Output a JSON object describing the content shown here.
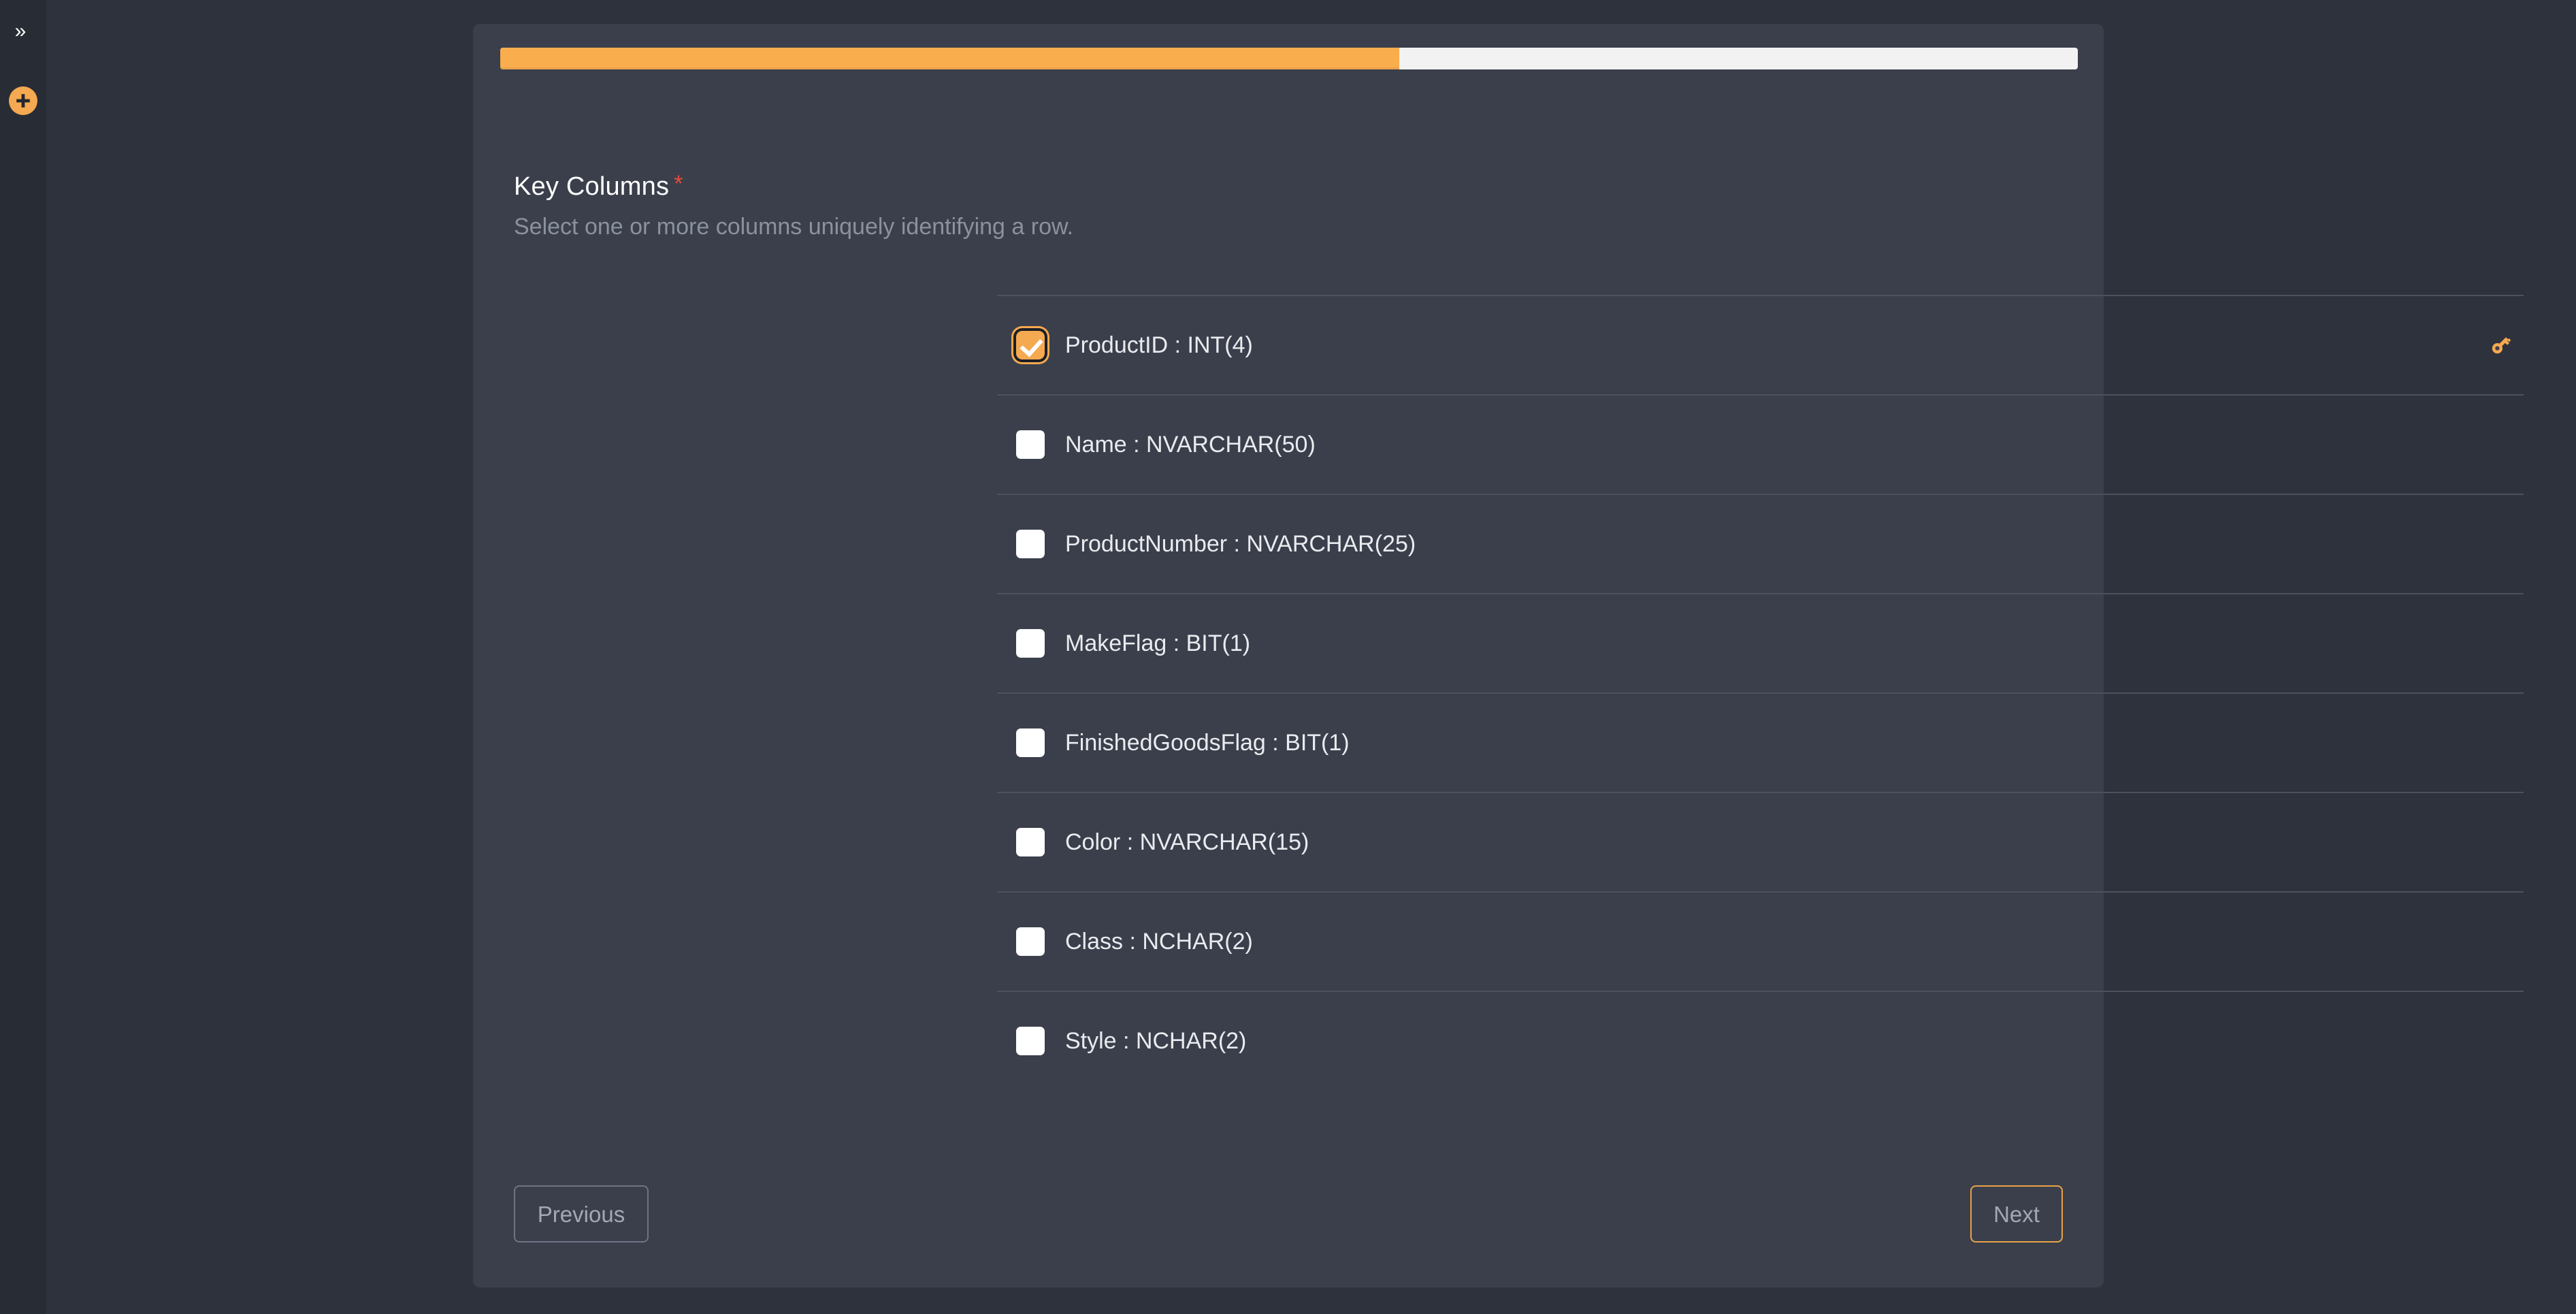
{
  "rail": {
    "expand_icon": "chevron-double-right-icon",
    "expand_label": "»",
    "add_icon": "plus-circle-icon",
    "accent_color": "#f5a950"
  },
  "wizard": {
    "progress": {
      "percent": 57,
      "fill_color": "#f9ad4d",
      "track_color": "#f2f2f2"
    },
    "section": {
      "title": "Key Columns",
      "required_marker": "*",
      "required_color": "#e74c3c",
      "subtitle": "Select one or more columns uniquely identifying a row."
    },
    "columns": [
      {
        "label": "ProductID : INT(4)",
        "name": "ProductID",
        "type": "INT",
        "length": "4",
        "checked": true,
        "key_icon": true
      },
      {
        "label": "Name : NVARCHAR(50)",
        "name": "Name",
        "type": "NVARCHAR",
        "length": "50",
        "checked": false,
        "key_icon": false
      },
      {
        "label": "ProductNumber : NVARCHAR(25)",
        "name": "ProductNumber",
        "type": "NVARCHAR",
        "length": "25",
        "checked": false,
        "key_icon": false
      },
      {
        "label": "MakeFlag : BIT(1)",
        "name": "MakeFlag",
        "type": "BIT",
        "length": "1",
        "checked": false,
        "key_icon": false
      },
      {
        "label": "FinishedGoodsFlag : BIT(1)",
        "name": "FinishedGoodsFlag",
        "type": "BIT",
        "length": "1",
        "checked": false,
        "key_icon": false
      },
      {
        "label": "Color : NVARCHAR(15)",
        "name": "Color",
        "type": "NVARCHAR",
        "length": "15",
        "checked": false,
        "key_icon": false
      },
      {
        "label": "Class : NCHAR(2)",
        "name": "Class",
        "type": "NCHAR",
        "length": "2",
        "checked": false,
        "key_icon": false
      },
      {
        "label": "Style : NCHAR(2)",
        "name": "Style",
        "type": "NCHAR",
        "length": "2",
        "checked": false,
        "key_icon": false
      }
    ],
    "footer": {
      "previous_label": "Previous",
      "next_label": "Next",
      "next_border_color": "#e8a24a"
    }
  }
}
